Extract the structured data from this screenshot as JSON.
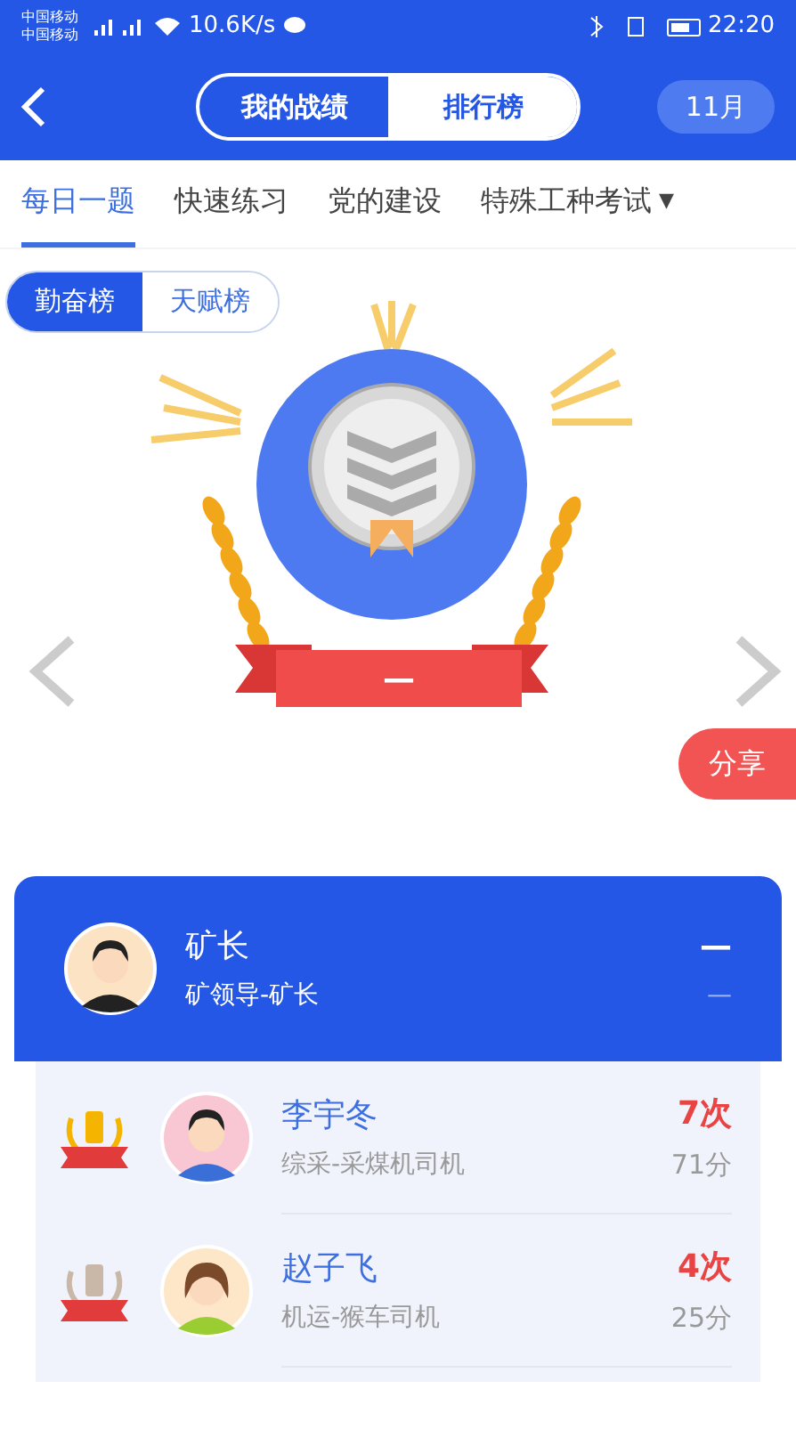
{
  "status_bar": {
    "carriers": [
      "中国移动",
      "中国移动"
    ],
    "speed": "10.6K/s",
    "time": "22:20"
  },
  "header": {
    "segments": [
      {
        "label": "我的战绩",
        "selected": false
      },
      {
        "label": "排行榜",
        "selected": true
      }
    ],
    "month": "11月"
  },
  "categories": [
    {
      "label": "每日一题",
      "selected": true
    },
    {
      "label": "快速练习",
      "selected": false
    },
    {
      "label": "党的建设",
      "selected": false
    },
    {
      "label": "特殊工种考试",
      "selected": false,
      "dropdown_icon": "▼"
    }
  ],
  "boards": [
    {
      "label": "勤奋榜",
      "selected": true
    },
    {
      "label": "天赋榜",
      "selected": false
    }
  ],
  "medal": {
    "ribbon": "—"
  },
  "share": "分享",
  "me": {
    "name": "矿长",
    "role": "矿领导-矿长",
    "count": "—",
    "score": "—"
  },
  "ranking": [
    {
      "kind": "gold",
      "name": "李宇冬",
      "role": "综采-采煤机司机",
      "count": "7次",
      "score": "71分"
    },
    {
      "kind": "silver",
      "name": "赵子飞",
      "role": "机运-猴车司机",
      "count": "4次",
      "score": "25分"
    }
  ]
}
